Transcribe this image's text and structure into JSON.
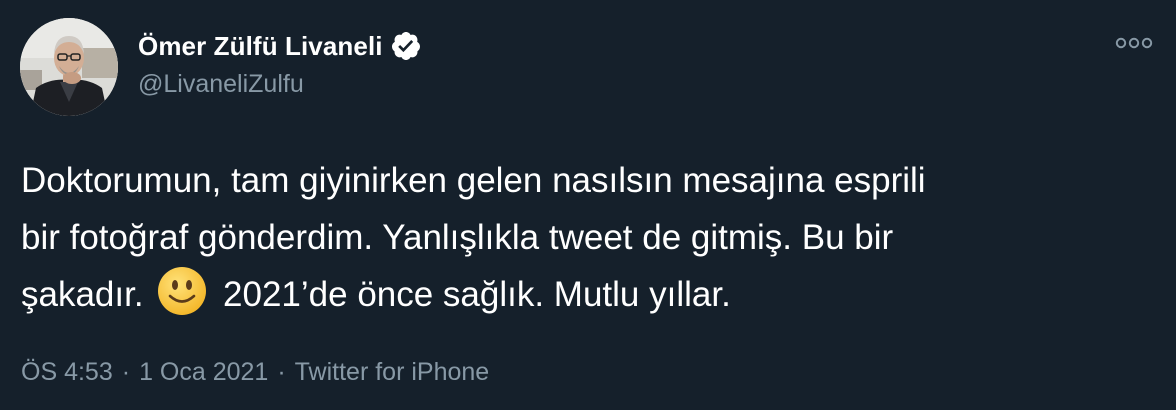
{
  "author": {
    "display_name": "Ömer Zülfü Livaneli",
    "handle": "@LivaneliZulfu",
    "verified_icon": "verified-badge-icon",
    "avatar": "profile-photo"
  },
  "tweet": {
    "text_part1": "Doktorumun, tam giyinirken gelen nasılsın mesajına esprili\nbir fotoğraf gönderdim. Yanlışlıkla tweet de gitmiş. Bu bir\nşakadır. ",
    "emoji": "slightly-smiling-face-icon",
    "text_part2": " 2021’de önce sağlık. Mutlu yıllar."
  },
  "meta": {
    "time": "ÖS 4:53",
    "separator": "·",
    "date": "1 Oca 2021",
    "source": "Twitter for iPhone"
  },
  "more_icon": "more-options-icon",
  "colors": {
    "background": "#15202b",
    "text": "#ffffff",
    "muted": "#8899a6",
    "verified": "#ffffff"
  }
}
